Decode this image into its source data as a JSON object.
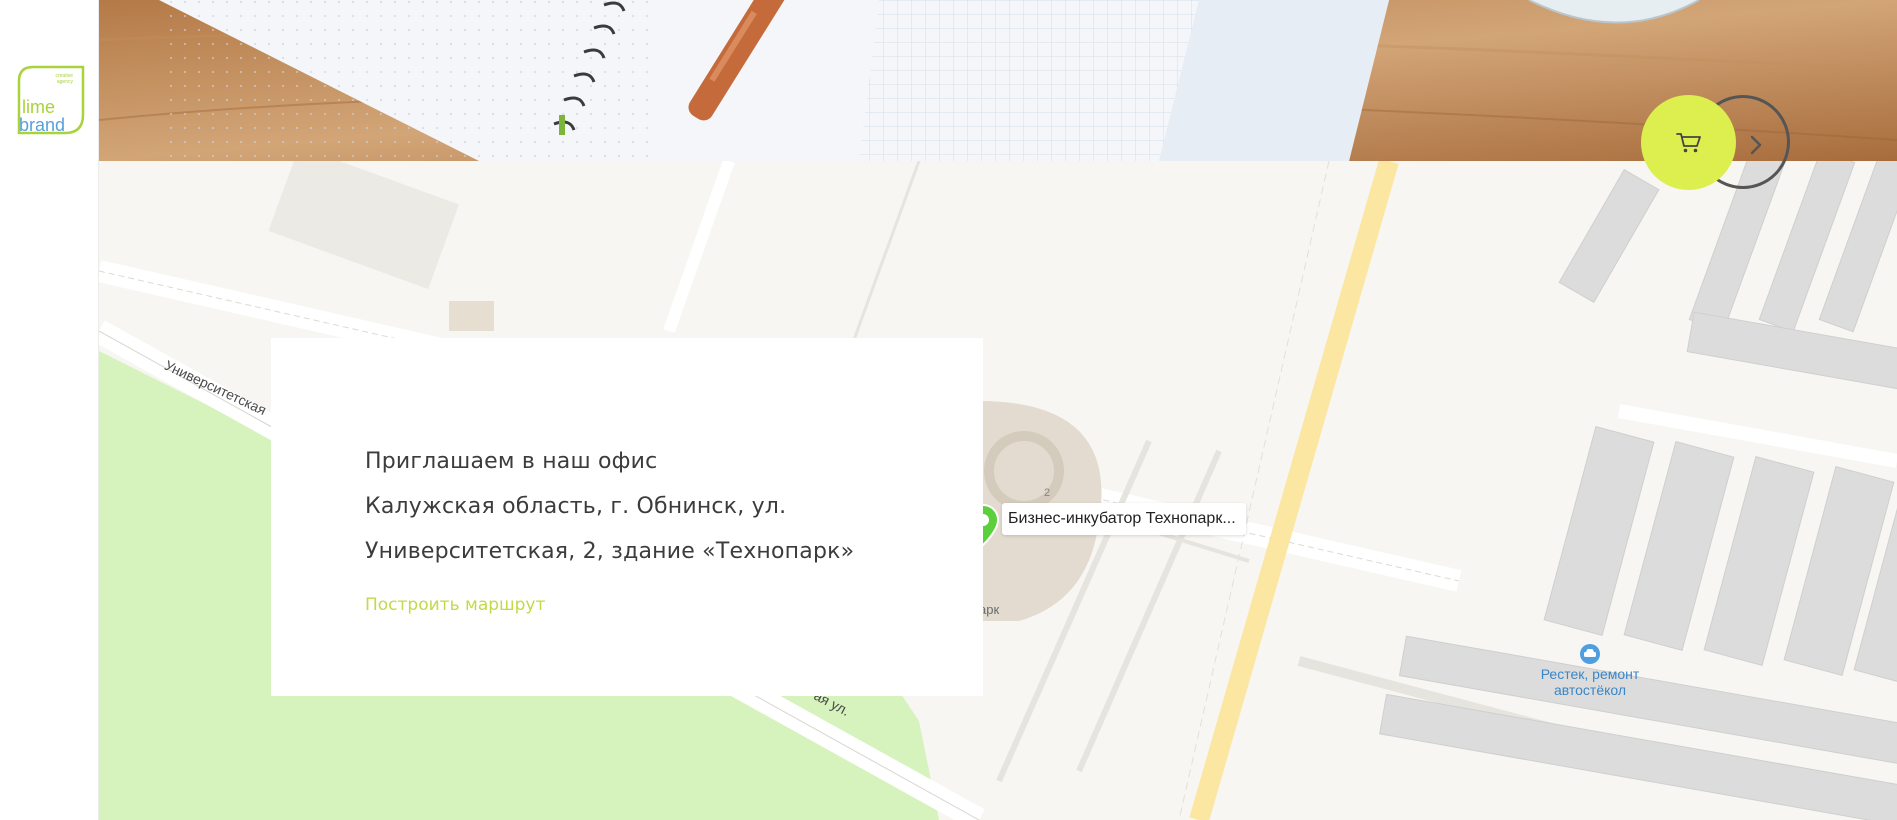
{
  "brand": {
    "logo_line1": "lime",
    "logo_line2": "brand",
    "logo_tag": "creative agency",
    "accent_color": "#dcef4f",
    "logo_green": "#a9d33b",
    "logo_blue": "#5aa0d8"
  },
  "controls": {
    "cart_icon": "cart-icon",
    "next_icon": "chevron-right-icon"
  },
  "office": {
    "heading": "Приглашаем в наш офис",
    "address_line1": "Калужская область, г. Обнинск, ул.",
    "address_line2": "Университетская, 2, здание «Технопарк»",
    "route_link": "Построить маршрут"
  },
  "map": {
    "poi_label": "Бизнес-инкубатор Технопарк...",
    "poi_icon": "location-pin-icon",
    "street_label_top": "Университетская",
    "street_label_bottom": "ая ул.",
    "building_number": "2",
    "partial_label": "арк",
    "service_label_line1": "Рестек, ремонт",
    "service_label_line2": "автостёкол",
    "service_icon": "car-icon",
    "park_color": "#d6f2bd",
    "road_color": "#fbe7a1",
    "building_color": "#dcdcdc"
  }
}
